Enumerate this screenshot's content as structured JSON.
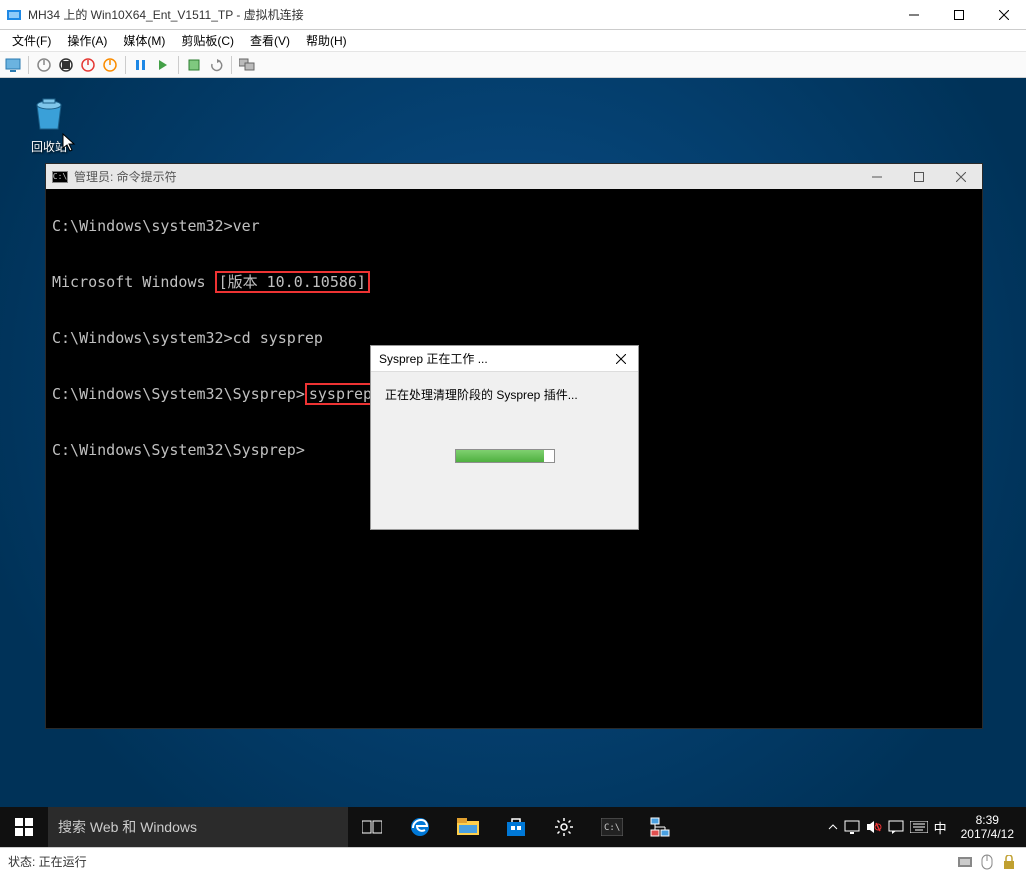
{
  "outer": {
    "title": "MH34 上的 Win10X64_Ent_V1511_TP - 虚拟机连接",
    "menus": [
      "文件(F)",
      "操作(A)",
      "媒体(M)",
      "剪贴板(C)",
      "查看(V)",
      "帮助(H)"
    ]
  },
  "desktop": {
    "recycle_label": "回收站"
  },
  "cmd": {
    "title": "管理员: 命令提示符",
    "line1_prompt": "C:\\Windows\\system32>",
    "line1_cmd": "ver",
    "line2_prefix": "Microsoft Windows ",
    "line2_version": "[版本 10.0.10586]",
    "line3_prompt": "C:\\Windows\\system32>",
    "line3_cmd": "cd sysprep",
    "line4_prompt": "C:\\Windows\\System32\\Sysprep>",
    "line4_cmd": "sysprep /generalize /shutdown",
    "line5_prompt": "C:\\Windows\\System32\\Sysprep>"
  },
  "sysprep": {
    "title": "Sysprep 正在工作 ...",
    "body": "正在处理清理阶段的 Sysprep 插件..."
  },
  "taskbar": {
    "search_placeholder": "搜索 Web 和 Windows"
  },
  "tray": {
    "ime": "中",
    "time": "8:39",
    "date": "2017/4/12"
  },
  "status": {
    "text": "状态: 正在运行"
  }
}
